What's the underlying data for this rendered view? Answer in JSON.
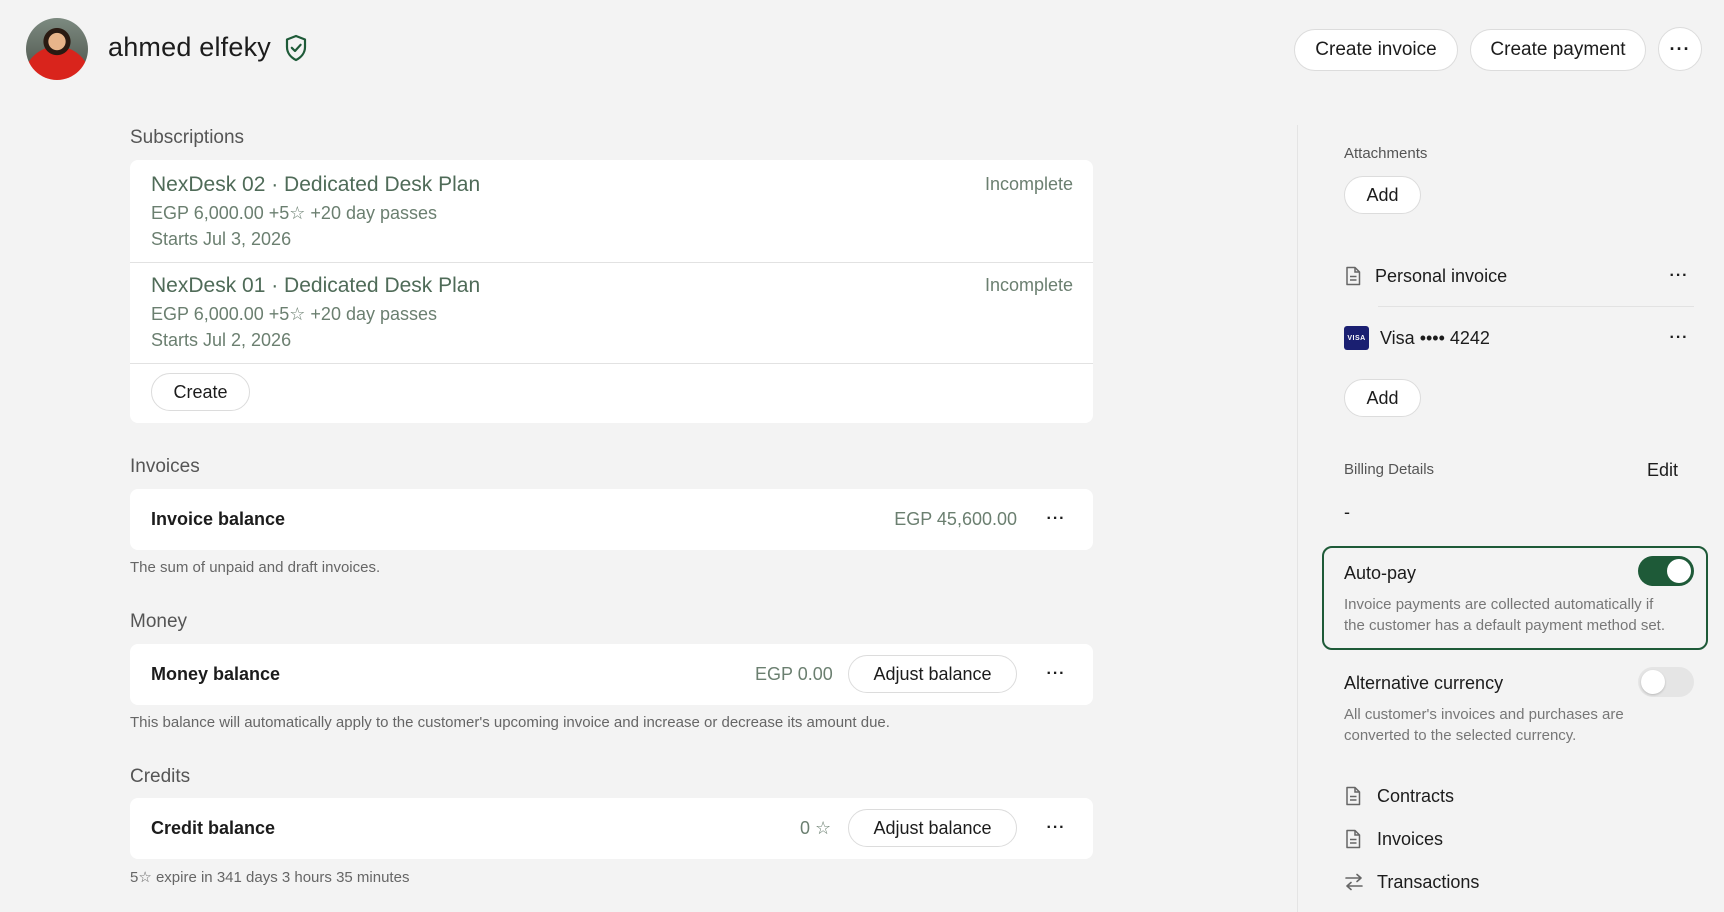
{
  "header": {
    "name": "ahmed elfeky",
    "create_invoice": "Create invoice",
    "create_payment": "Create payment",
    "more": "···"
  },
  "subscriptions": {
    "label": "Subscriptions",
    "items": [
      {
        "title": "NexDesk 02 · Dedicated Desk Plan",
        "price": "EGP 6,000.00 +5☆ +20 day passes",
        "start": "Starts Jul 3, 2026",
        "status": "Incomplete"
      },
      {
        "title": "NexDesk 01 · Dedicated Desk Plan",
        "price": "EGP 6,000.00 +5☆ +20 day passes",
        "start": "Starts Jul 2, 2026",
        "status": "Incomplete"
      }
    ],
    "create": "Create"
  },
  "invoices": {
    "label": "Invoices",
    "row_label": "Invoice balance",
    "value": "EGP 45,600.00",
    "hint": "The sum of unpaid and draft invoices."
  },
  "money": {
    "label": "Money",
    "row_label": "Money balance",
    "value": "EGP 0.00",
    "adjust": "Adjust balance",
    "hint": "This balance will automatically apply to the customer's upcoming invoice and increase or decrease its amount due."
  },
  "credits": {
    "label": "Credits",
    "row_label": "Credit balance",
    "value": "0 ☆",
    "adjust": "Adjust balance",
    "hint": "5☆ expire in 341 days 3 hours 35 minutes"
  },
  "sidebar": {
    "attachments_label": "Attachments",
    "add": "Add",
    "personal_invoice": "Personal invoice",
    "visa_badge": "VISA",
    "visa": "Visa •••• 4242",
    "add_payment": "Add",
    "billing_label": "Billing Details",
    "edit": "Edit",
    "billing_value": "-",
    "autopay_title": "Auto-pay",
    "autopay_desc1": "Invoice payments are collected automatically if",
    "autopay_desc2": "the customer has a default payment method set.",
    "autopay_on": true,
    "altcur_title": "Alternative currency",
    "altcur_desc1": "All customer's invoices and purchases are",
    "altcur_desc2": "converted to the selected currency.",
    "altcur_on": false,
    "links": [
      "Contracts",
      "Invoices",
      "Transactions"
    ]
  },
  "colors": {
    "accent": "#1e5a38",
    "muted_green": "#6b7f70"
  }
}
